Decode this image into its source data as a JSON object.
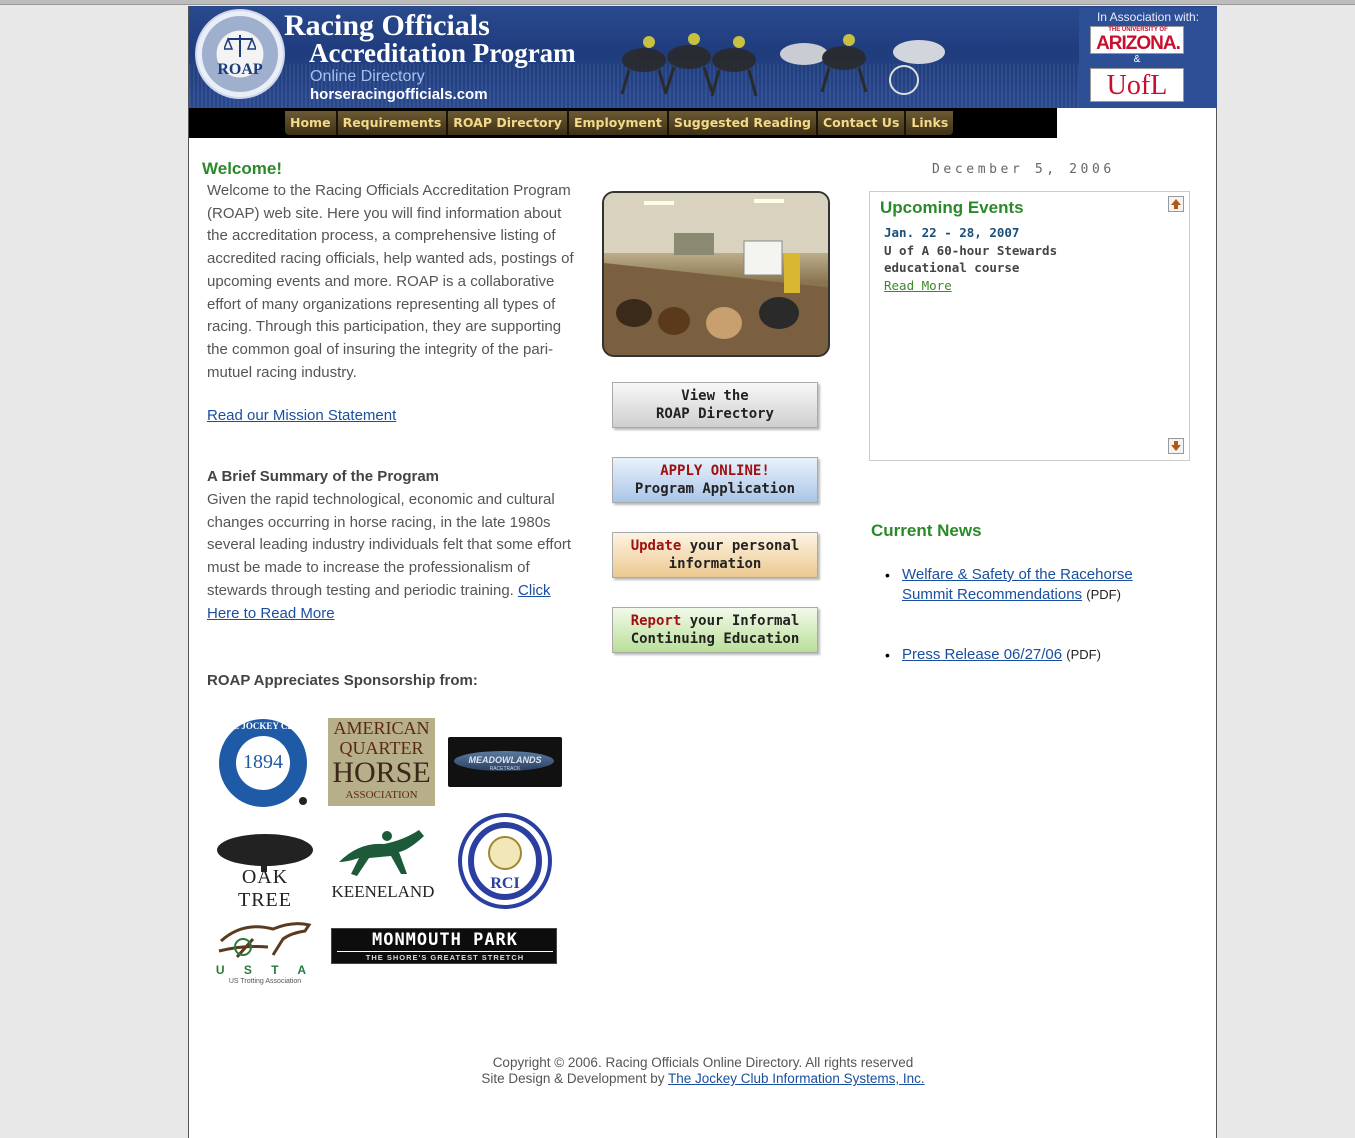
{
  "header": {
    "logo_text": "ROAP",
    "title_line1": "Racing Officials",
    "title_line2": "Accreditation Program",
    "subtitle": "Online Directory",
    "domain": "horseracingofficials.com",
    "association_label": "In Association with:",
    "partner1_small": "THE UNIVERSITY OF",
    "partner1": "ARIZONA.",
    "amp": "&",
    "partner2": "UofL"
  },
  "nav": {
    "items": [
      {
        "label": "Home"
      },
      {
        "label": "Requirements"
      },
      {
        "label": "ROAP Directory"
      },
      {
        "label": "Employment"
      },
      {
        "label": "Suggested Reading"
      },
      {
        "label": "Contact Us"
      },
      {
        "label": "Links"
      }
    ]
  },
  "welcome": {
    "heading": "Welcome!",
    "text": "Welcome to the Racing Officials Accreditation Program (ROAP) web site. Here you will find information about the accreditation process, a comprehensive listing of accredited racing officials, help wanted ads, postings of upcoming events and more. ROAP is a collaborative effort of many organizations representing all types of racing. Through this participation, they are supporting the common goal of insuring the integrity of the pari-mutuel racing industry.",
    "mission_link": "Read our Mission Statement"
  },
  "summary": {
    "heading": "A Brief Summary of the Program",
    "text": "Given the rapid technological, economic and cultural changes occurring in horse racing, in the late 1980s several leading industry individuals felt that some effort must be made to increase the professionalism of stewards through testing and periodic training.",
    "read_more": "Click Here to Read More"
  },
  "sponsors": {
    "heading": "ROAP Appreciates Sponsorship from:",
    "jockey_club": {
      "line1": "THE JOCKEY CLUB",
      "year": "1894"
    },
    "aqha": {
      "line1": "AMERICAN",
      "line2": "QUARTER",
      "line3": "HORSE",
      "line4": "ASSOCIATION"
    },
    "meadowlands": {
      "name": "MEADOWLANDS",
      "sub": "RACETRACK"
    },
    "oak_tree": {
      "name": "OAK TREE"
    },
    "keeneland": {
      "name": "KEENELAND"
    },
    "rci": {
      "name": "RCI"
    },
    "usta": {
      "letters": "U S T A",
      "sub": "US Trotting Association"
    },
    "monmouth": {
      "name": "MONMOUTH PARK",
      "tagline": "THE SHORE'S GREATEST STRETCH"
    }
  },
  "actions": {
    "directory": {
      "line1": "View the",
      "line2": "ROAP Directory"
    },
    "apply": {
      "line1": "APPLY ONLINE!",
      "line2": "Program Application"
    },
    "update": {
      "highlight": "Update",
      "rest": " your personal",
      "line2": "information"
    },
    "report": {
      "highlight": "Report",
      "rest": " your Informal",
      "line2": "Continuing Education"
    }
  },
  "date": "December 5, 2006",
  "events": {
    "heading": "Upcoming Events",
    "items": [
      {
        "date": "Jan. 22 - 28, 2007",
        "description": "U of A 60-hour Stewards educational course",
        "link": "Read More"
      }
    ]
  },
  "news": {
    "heading": "Current News",
    "items": [
      {
        "line1": "Welfare & Safety of the Racehorse",
        "line2": "Summit Recommendations",
        "suffix": "(PDF)"
      },
      {
        "line1": "Press Release 06/27/06",
        "suffix": "(PDF)"
      }
    ]
  },
  "footer": {
    "copyright": "Copyright © 2006. Racing Officials Online Directory. All rights reserved",
    "design_prefix": "Site Design & Development by ",
    "design_link": "The Jockey Club Information Systems, Inc."
  }
}
